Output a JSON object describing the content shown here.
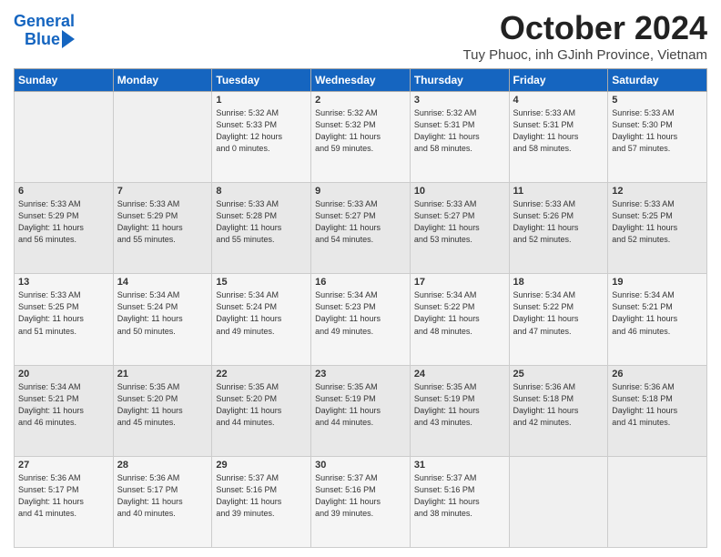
{
  "logo": {
    "line1": "General",
    "line2": "Blue"
  },
  "header": {
    "month_title": "October 2024",
    "subtitle": "Tuy Phuoc, inh GJinh Province, Vietnam"
  },
  "days_of_week": [
    "Sunday",
    "Monday",
    "Tuesday",
    "Wednesday",
    "Thursday",
    "Friday",
    "Saturday"
  ],
  "weeks": [
    [
      {
        "day": "",
        "info": ""
      },
      {
        "day": "",
        "info": ""
      },
      {
        "day": "1",
        "info": "Sunrise: 5:32 AM\nSunset: 5:33 PM\nDaylight: 12 hours\nand 0 minutes."
      },
      {
        "day": "2",
        "info": "Sunrise: 5:32 AM\nSunset: 5:32 PM\nDaylight: 11 hours\nand 59 minutes."
      },
      {
        "day": "3",
        "info": "Sunrise: 5:32 AM\nSunset: 5:31 PM\nDaylight: 11 hours\nand 58 minutes."
      },
      {
        "day": "4",
        "info": "Sunrise: 5:33 AM\nSunset: 5:31 PM\nDaylight: 11 hours\nand 58 minutes."
      },
      {
        "day": "5",
        "info": "Sunrise: 5:33 AM\nSunset: 5:30 PM\nDaylight: 11 hours\nand 57 minutes."
      }
    ],
    [
      {
        "day": "6",
        "info": "Sunrise: 5:33 AM\nSunset: 5:29 PM\nDaylight: 11 hours\nand 56 minutes."
      },
      {
        "day": "7",
        "info": "Sunrise: 5:33 AM\nSunset: 5:29 PM\nDaylight: 11 hours\nand 55 minutes."
      },
      {
        "day": "8",
        "info": "Sunrise: 5:33 AM\nSunset: 5:28 PM\nDaylight: 11 hours\nand 55 minutes."
      },
      {
        "day": "9",
        "info": "Sunrise: 5:33 AM\nSunset: 5:27 PM\nDaylight: 11 hours\nand 54 minutes."
      },
      {
        "day": "10",
        "info": "Sunrise: 5:33 AM\nSunset: 5:27 PM\nDaylight: 11 hours\nand 53 minutes."
      },
      {
        "day": "11",
        "info": "Sunrise: 5:33 AM\nSunset: 5:26 PM\nDaylight: 11 hours\nand 52 minutes."
      },
      {
        "day": "12",
        "info": "Sunrise: 5:33 AM\nSunset: 5:25 PM\nDaylight: 11 hours\nand 52 minutes."
      }
    ],
    [
      {
        "day": "13",
        "info": "Sunrise: 5:33 AM\nSunset: 5:25 PM\nDaylight: 11 hours\nand 51 minutes."
      },
      {
        "day": "14",
        "info": "Sunrise: 5:34 AM\nSunset: 5:24 PM\nDaylight: 11 hours\nand 50 minutes."
      },
      {
        "day": "15",
        "info": "Sunrise: 5:34 AM\nSunset: 5:24 PM\nDaylight: 11 hours\nand 49 minutes."
      },
      {
        "day": "16",
        "info": "Sunrise: 5:34 AM\nSunset: 5:23 PM\nDaylight: 11 hours\nand 49 minutes."
      },
      {
        "day": "17",
        "info": "Sunrise: 5:34 AM\nSunset: 5:22 PM\nDaylight: 11 hours\nand 48 minutes."
      },
      {
        "day": "18",
        "info": "Sunrise: 5:34 AM\nSunset: 5:22 PM\nDaylight: 11 hours\nand 47 minutes."
      },
      {
        "day": "19",
        "info": "Sunrise: 5:34 AM\nSunset: 5:21 PM\nDaylight: 11 hours\nand 46 minutes."
      }
    ],
    [
      {
        "day": "20",
        "info": "Sunrise: 5:34 AM\nSunset: 5:21 PM\nDaylight: 11 hours\nand 46 minutes."
      },
      {
        "day": "21",
        "info": "Sunrise: 5:35 AM\nSunset: 5:20 PM\nDaylight: 11 hours\nand 45 minutes."
      },
      {
        "day": "22",
        "info": "Sunrise: 5:35 AM\nSunset: 5:20 PM\nDaylight: 11 hours\nand 44 minutes."
      },
      {
        "day": "23",
        "info": "Sunrise: 5:35 AM\nSunset: 5:19 PM\nDaylight: 11 hours\nand 44 minutes."
      },
      {
        "day": "24",
        "info": "Sunrise: 5:35 AM\nSunset: 5:19 PM\nDaylight: 11 hours\nand 43 minutes."
      },
      {
        "day": "25",
        "info": "Sunrise: 5:36 AM\nSunset: 5:18 PM\nDaylight: 11 hours\nand 42 minutes."
      },
      {
        "day": "26",
        "info": "Sunrise: 5:36 AM\nSunset: 5:18 PM\nDaylight: 11 hours\nand 41 minutes."
      }
    ],
    [
      {
        "day": "27",
        "info": "Sunrise: 5:36 AM\nSunset: 5:17 PM\nDaylight: 11 hours\nand 41 minutes."
      },
      {
        "day": "28",
        "info": "Sunrise: 5:36 AM\nSunset: 5:17 PM\nDaylight: 11 hours\nand 40 minutes."
      },
      {
        "day": "29",
        "info": "Sunrise: 5:37 AM\nSunset: 5:16 PM\nDaylight: 11 hours\nand 39 minutes."
      },
      {
        "day": "30",
        "info": "Sunrise: 5:37 AM\nSunset: 5:16 PM\nDaylight: 11 hours\nand 39 minutes."
      },
      {
        "day": "31",
        "info": "Sunrise: 5:37 AM\nSunset: 5:16 PM\nDaylight: 11 hours\nand 38 minutes."
      },
      {
        "day": "",
        "info": ""
      },
      {
        "day": "",
        "info": ""
      }
    ]
  ]
}
